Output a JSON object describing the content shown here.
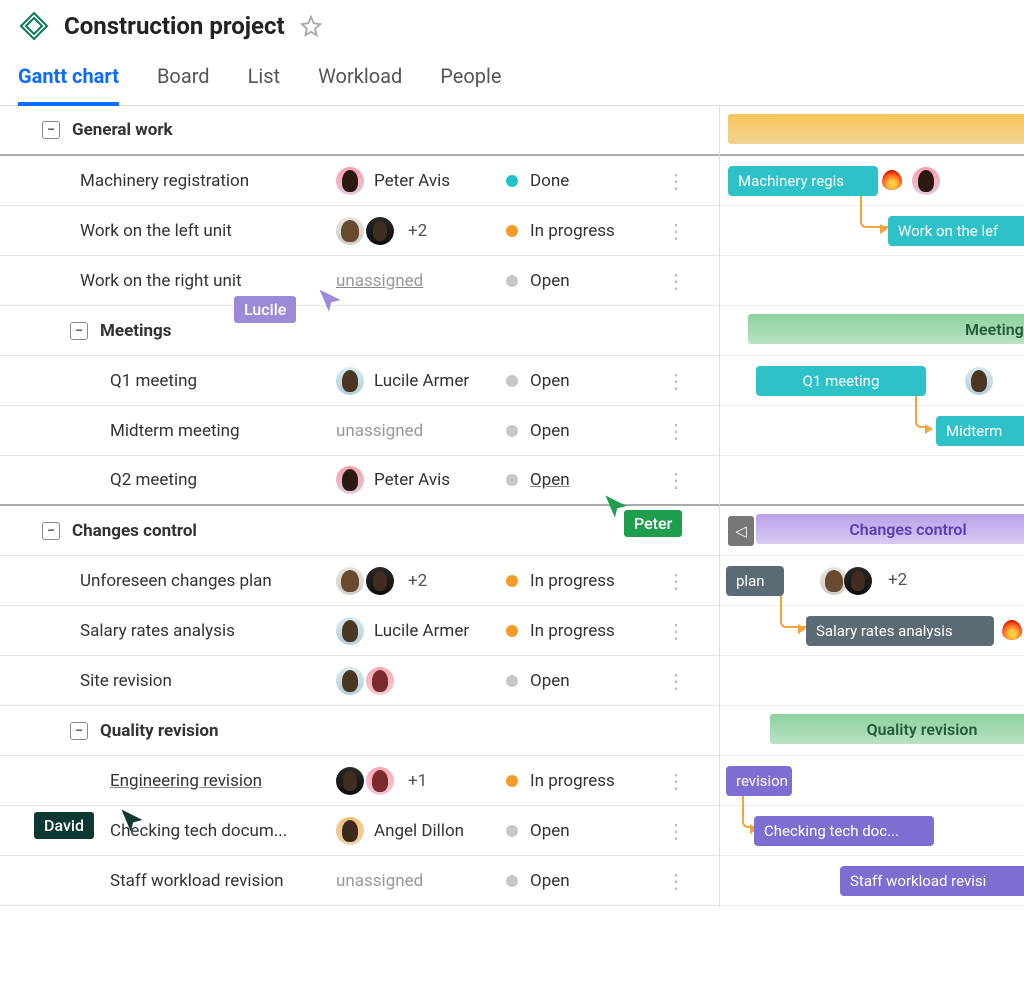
{
  "header": {
    "title": "Construction project"
  },
  "tabs": [
    "Gantt chart",
    "Board",
    "List",
    "Workload",
    "People"
  ],
  "groups": [
    {
      "name": "General work",
      "tasks": [
        {
          "name": "Machinery registration",
          "assignee": "Peter Avis",
          "status": "Done",
          "status_key": "done",
          "avatars": [
            "peter"
          ]
        },
        {
          "name": "Work on the left unit",
          "assignee": "+2",
          "status": "In progress",
          "status_key": "inprog",
          "avatars": [
            "man1",
            "man2"
          ],
          "plus": "+2"
        },
        {
          "name": "Work on the right unit",
          "assignee": "unassigned",
          "status": "Open",
          "status_key": "open",
          "avatars": []
        }
      ],
      "subgroups": [
        {
          "name": "Meetings",
          "tasks": [
            {
              "name": "Q1 meeting",
              "assignee": "Lucile Armer",
              "status": "Open",
              "status_key": "open",
              "avatars": [
                "lucile"
              ]
            },
            {
              "name": "Midterm meeting",
              "assignee": "unassigned",
              "status": "Open",
              "status_key": "open",
              "avatars": []
            },
            {
              "name": "Q2 meeting",
              "assignee": "Peter Avis",
              "status": "Open",
              "status_key": "open",
              "avatars": [
                "peter"
              ],
              "status_underline": true
            }
          ]
        }
      ]
    },
    {
      "name": "Changes control",
      "tasks": [
        {
          "name": "Unforeseen changes plan",
          "assignee": "+2",
          "status": "In progress",
          "status_key": "inprog",
          "avatars": [
            "man1",
            "man2"
          ],
          "plus": "+2"
        },
        {
          "name": "Salary rates analysis",
          "assignee": "Lucile Armer",
          "status": "In progress",
          "status_key": "inprog",
          "avatars": [
            "lucile"
          ]
        },
        {
          "name": "Site revision",
          "assignee": "",
          "status": "Open",
          "status_key": "open",
          "avatars": [
            "lucile",
            "pink"
          ]
        }
      ],
      "subgroups": [
        {
          "name": "Quality revision",
          "tasks": [
            {
              "name": "Engineering revision",
              "assignee": "+1",
              "status": "In progress",
              "status_key": "inprog",
              "avatars": [
                "man2",
                "pink"
              ],
              "plus": "+1",
              "name_underline": true
            },
            {
              "name": "Checking tech docum...",
              "assignee": "Angel Dillon",
              "status": "Open",
              "status_key": "open",
              "avatars": [
                "angel"
              ]
            },
            {
              "name": "Staff workload revision",
              "assignee": "unassigned",
              "status": "Open",
              "status_key": "open",
              "avatars": []
            }
          ]
        }
      ]
    }
  ],
  "gantt": {
    "bars": {
      "machinery": "Machinery regis",
      "work_left": "Work on the lef",
      "meetings_summary": "Meetings",
      "q1": "Q1 meeting",
      "midterm": "Midterm",
      "changes_summary": "Changes control",
      "plan": "plan",
      "salary": "Salary rates analysis",
      "quality_summary": "Quality revision",
      "revision": "revision",
      "checking": "Checking tech doc...",
      "staff": "Staff workload revisi"
    },
    "plus2": "+2"
  },
  "cursors": {
    "lucile": "Lucile",
    "peter": "Peter",
    "david": "David"
  }
}
